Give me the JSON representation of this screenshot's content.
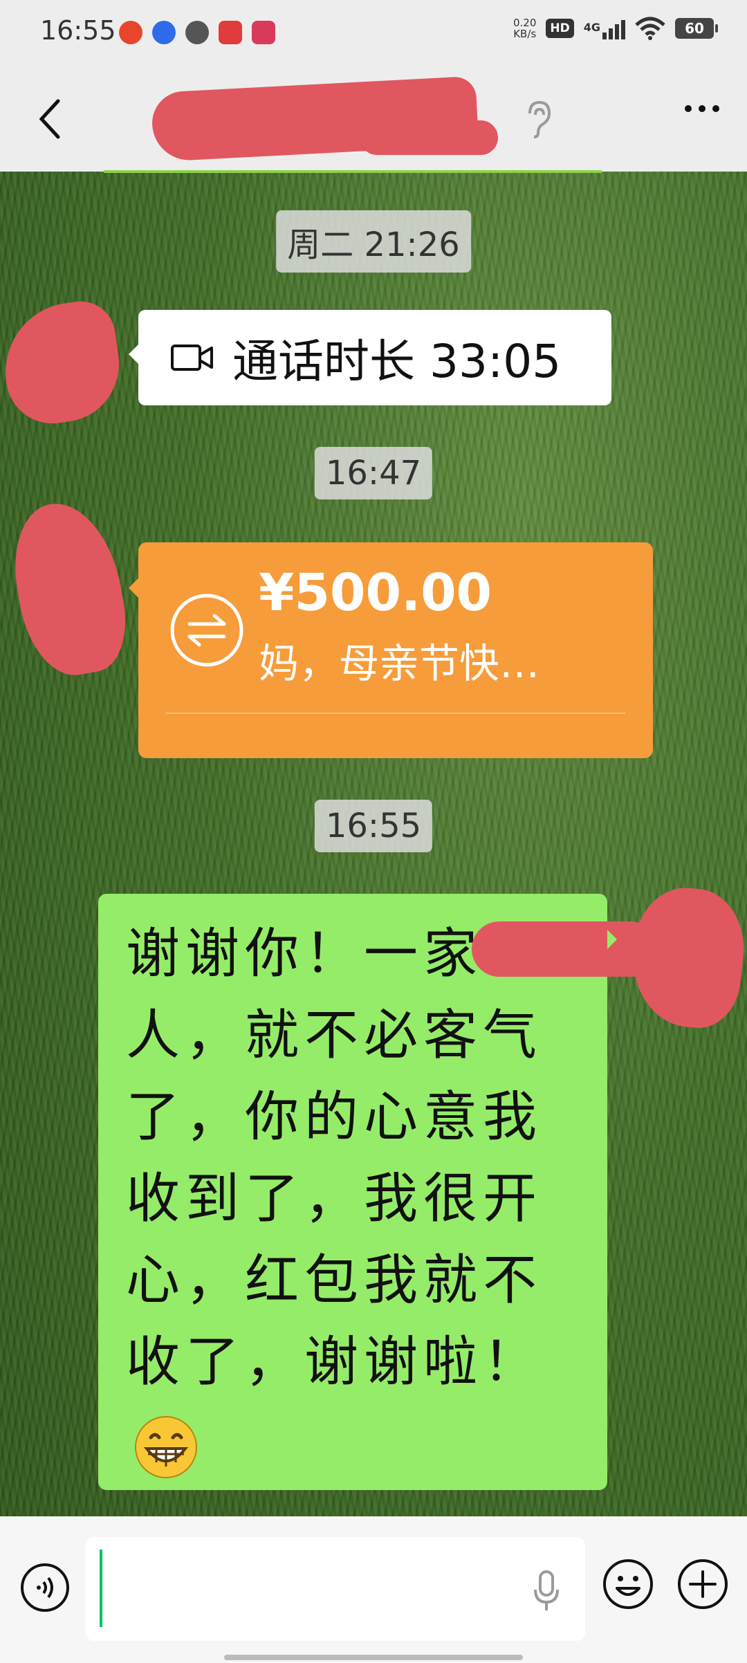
{
  "status_bar": {
    "time": "16:55",
    "net_speed_value": "0.20",
    "net_speed_unit": "KB/s",
    "hd": "HD",
    "network": "4G",
    "battery": "60",
    "app_icons": [
      "toutiao-app-icon",
      "baidu-app-icon",
      "link-app-icon",
      "news-app-icon",
      "weibo-app-icon"
    ]
  },
  "header": {
    "back_icon": "chevron-left-icon",
    "ear_icon": "ear-icon",
    "more_icon": "more-dots-icon"
  },
  "messages": {
    "timestamp_1": "周二 21:26",
    "call_duration": "通话时长 33:05",
    "timestamp_2": "16:47",
    "transfer_amount": "¥500.00",
    "transfer_note": "妈，母亲节快…",
    "timestamp_3": "16:55",
    "reply_text": "谢谢你！一家人，就不必客气了，你的心意我收到了，我很开心，红包我就不收了，谢谢啦！"
  },
  "input_bar": {
    "voice_icon": "voice-mode-icon",
    "mic_icon": "microphone-icon",
    "emoji_icon": "emoji-icon",
    "plus_icon": "plus-icon"
  },
  "colors": {
    "bubble_sent": "#95ec69",
    "transfer": "#f79c3a",
    "redaction": "#e1575f"
  }
}
